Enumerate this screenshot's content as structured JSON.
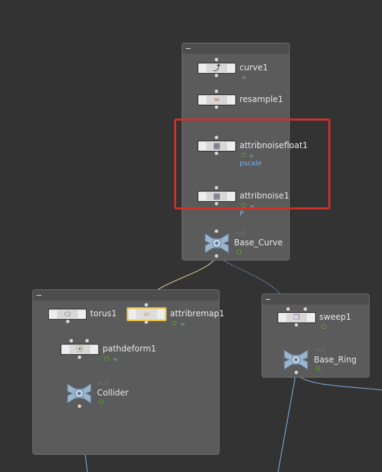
{
  "network_boxes": [
    {
      "id": "box-top",
      "collapse_icon": "minus-icon"
    },
    {
      "id": "box-left",
      "collapse_icon": "minus-icon"
    },
    {
      "id": "box-right",
      "collapse_icon": "minus-icon"
    }
  ],
  "nodes": {
    "curve1": {
      "label": "curve1",
      "icon": "curve-icon"
    },
    "resample1": {
      "label": "resample1",
      "icon": "resample-icon"
    },
    "attribnoisefloat1": {
      "label": "attribnoisefloat1",
      "sub": "pscale",
      "icon": "attribnoise-icon"
    },
    "attribnoise1": {
      "label": "attribnoise1",
      "sub": "P",
      "icon": "attribnoise-icon"
    },
    "base_curve": {
      "label": "Base_Curve",
      "type": "null",
      "icon": "null-icon"
    },
    "torus1": {
      "label": "torus1",
      "icon": "torus-icon"
    },
    "attribremap1": {
      "label": "attribremap1",
      "icon": "attribremap-icon",
      "selected": true
    },
    "pathdeform1": {
      "label": "pathdeform1",
      "icon": "pathdeform-icon"
    },
    "collider": {
      "label": "Collider",
      "type": "null",
      "icon": "null-icon"
    },
    "sweep1": {
      "label": "sweep1",
      "icon": "sweep-icon"
    },
    "base_ring": {
      "label": "Base_Ring",
      "type": "null",
      "icon": "null-icon"
    }
  },
  "colors": {
    "background": "#333333",
    "netbox": "#5b5b5b",
    "node_body": "#d7d7d7",
    "selected_outline": "#f0c53b",
    "highlight_outline": "#d0302a",
    "wire": "#9aa0a8",
    "selected_wire": "#c9c48a",
    "sub_label": "#7bb0e6",
    "display_flag": "#8bd14f"
  }
}
